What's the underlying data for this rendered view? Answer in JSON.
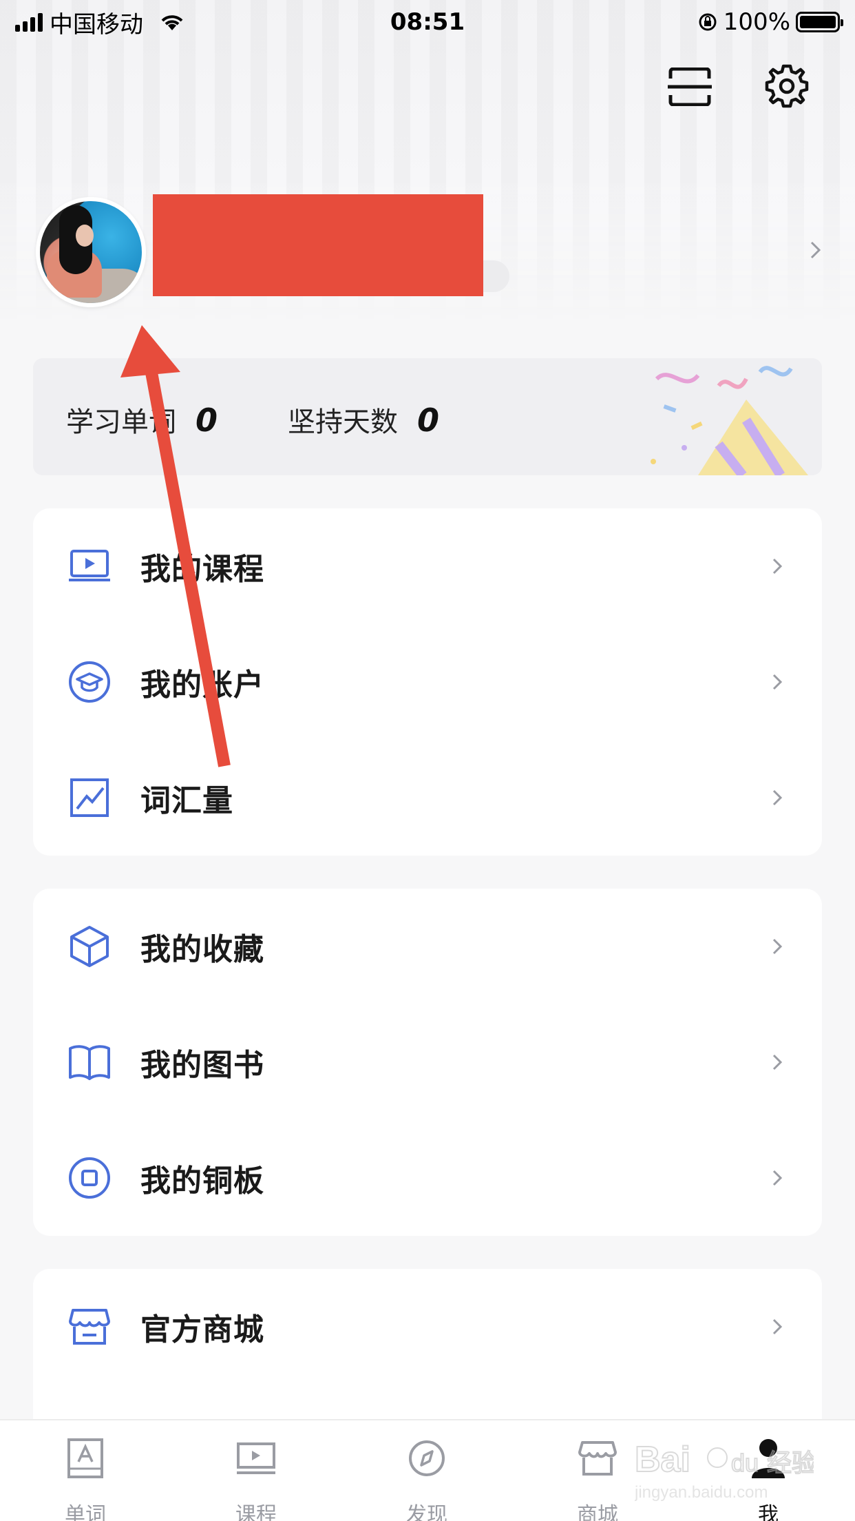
{
  "status_bar": {
    "carrier": "中国移动",
    "time": "08:51",
    "battery": "100%"
  },
  "header": {
    "icons": [
      "scan-icon",
      "gear-icon"
    ]
  },
  "stats": {
    "words_label": "学习单词",
    "words_value": "0",
    "days_label": "坚持天数",
    "days_value": "0"
  },
  "menu_group_1": [
    {
      "label": "我的课程",
      "icon": "video-course-icon"
    },
    {
      "label": "我的账户",
      "icon": "graduation-cap-icon"
    },
    {
      "label": "词汇量",
      "icon": "chart-trend-icon"
    }
  ],
  "menu_group_2": [
    {
      "label": "我的收藏",
      "icon": "cube-icon"
    },
    {
      "label": "我的图书",
      "icon": "book-icon"
    },
    {
      "label": "我的铜板",
      "icon": "coin-icon"
    }
  ],
  "menu_group_3": [
    {
      "label": "官方商城",
      "icon": "store-icon"
    }
  ],
  "bottom_nav": [
    {
      "label": "单词",
      "icon": "word-card-icon"
    },
    {
      "label": "课程",
      "icon": "course-icon"
    },
    {
      "label": "发现",
      "icon": "compass-icon"
    },
    {
      "label": "商城",
      "icon": "shop-icon"
    },
    {
      "label": "我",
      "icon": "profile-icon",
      "active": true
    }
  ],
  "colors": {
    "accent": "#4a6fd9",
    "annotation": "#e74c3c",
    "background": "#f7f7f8"
  }
}
